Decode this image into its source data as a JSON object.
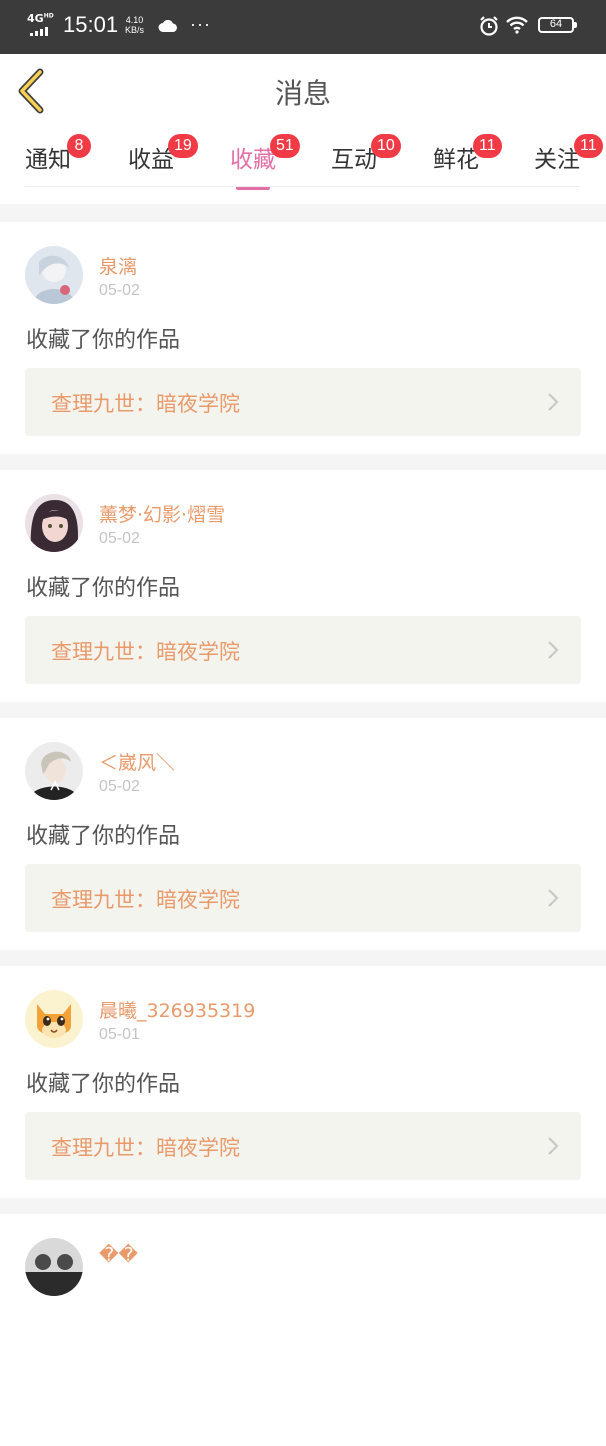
{
  "status_bar": {
    "network": "4G",
    "network_sup": "HD",
    "time": "15:01",
    "speed_value": "4.10",
    "speed_unit": "KB/s",
    "more": "···",
    "battery": "64"
  },
  "header": {
    "title": "消息"
  },
  "tabs": [
    {
      "label": "通知",
      "badge": "8"
    },
    {
      "label": "收益",
      "badge": "19"
    },
    {
      "label": "收藏",
      "badge": "51",
      "active": true
    },
    {
      "label": "互动",
      "badge": "10"
    },
    {
      "label": "鲜花",
      "badge": "11"
    },
    {
      "label": "关注",
      "badge": "11"
    }
  ],
  "items": [
    {
      "username": "泉漓",
      "date": "05-02",
      "action": "收藏了你的作品",
      "work_title": "查理九世：暗夜学院"
    },
    {
      "username": "薰梦·幻影·熠雪",
      "date": "05-02",
      "action": "收藏了你的作品",
      "work_title": "查理九世：暗夜学院"
    },
    {
      "username": "＜崴风＼",
      "date": "05-02",
      "action": "收藏了你的作品",
      "work_title": "查理九世：暗夜学院"
    },
    {
      "username": "晨曦_326935319",
      "date": "05-01",
      "action": "收藏了你的作品",
      "work_title": "查理九世：暗夜学院"
    },
    {
      "username": "��",
      "date": "",
      "action": "",
      "work_title": ""
    }
  ],
  "colors": {
    "accent_pink": "#e46fa6",
    "badge_red": "#f03a45",
    "username_orange": "#e89a6b",
    "status_bar_bg": "#3b3b3b",
    "page_bg": "#f5f5f5"
  }
}
